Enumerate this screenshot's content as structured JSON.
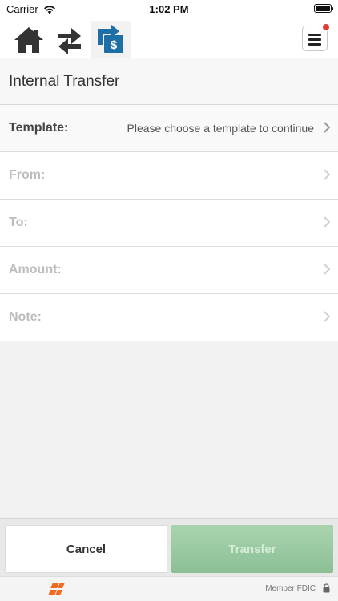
{
  "status_bar": {
    "carrier": "Carrier",
    "time": "1:02 PM"
  },
  "nav": {
    "icons": [
      "home-icon",
      "transfers-swap-icon",
      "internal-transfer-icon",
      "menu-icon"
    ],
    "accent_color": "#1d6fa5"
  },
  "page": {
    "title": "Internal Transfer"
  },
  "form": {
    "template": {
      "label": "Template:",
      "value": "Please choose a template to continue"
    },
    "from": {
      "label": "From:"
    },
    "to": {
      "label": "To:"
    },
    "amount": {
      "label": "Amount:"
    },
    "note": {
      "label": "Note:"
    }
  },
  "buttons": {
    "cancel": "Cancel",
    "transfer": "Transfer",
    "transfer_color": "#8cbf95"
  },
  "footer": {
    "member_text": "Member FDIC",
    "logo_color": "#f26a21"
  }
}
